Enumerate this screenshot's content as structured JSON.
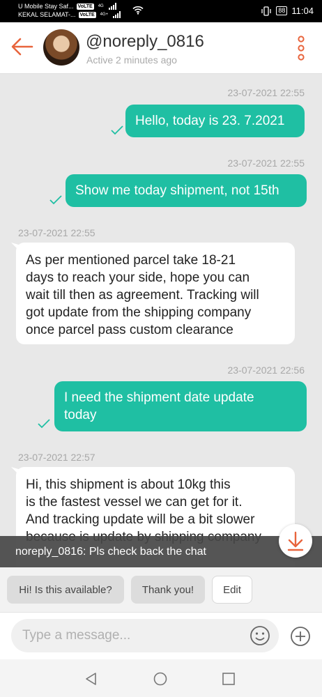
{
  "status_bar": {
    "carrier_line1": "U Mobile Stay Saf...",
    "carrier_line2": "KEKAL SELAMAT-...",
    "volte": "VoLTE",
    "net1": "4G",
    "net2": "4G+",
    "battery": "88",
    "time": "11:04"
  },
  "header": {
    "username": "@noreply_0816",
    "active_status": "Active 2 minutes ago"
  },
  "messages": [
    {
      "direction": "out",
      "timestamp": "23-07-2021 22:55",
      "lines": [
        "Hello, today is 23. 7.2021"
      ]
    },
    {
      "direction": "out",
      "timestamp": "23-07-2021 22:55",
      "lines": [
        "Show me today shipment, not 15th"
      ]
    },
    {
      "direction": "in",
      "timestamp": "23-07-2021 22:55",
      "lines": [
        "As per mentioned parcel take 18-21",
        "days to reach your side, hope you can",
        "wait till then as agreement. Tracking will",
        "got update from the shipping company",
        "once parcel pass custom clearance"
      ]
    },
    {
      "direction": "out",
      "timestamp": "23-07-2021 22:56",
      "lines": [
        "I need the shipment date update",
        "today"
      ]
    },
    {
      "direction": "in",
      "timestamp": "23-07-2021 22:57",
      "lines": [
        "Hi, this shipment is about 10kg this",
        "is the fastest vessel we can get for it.",
        "And tracking update will be a bit slower",
        "because is update by shipping company"
      ]
    }
  ],
  "banner": {
    "text": "noreply_0816: Pls check back the chat"
  },
  "quick_replies": [
    "Hi! Is this available?",
    "Thank you!",
    "Edit"
  ],
  "input": {
    "placeholder": "Type a message..."
  },
  "colors": {
    "accent": "#e8643c",
    "outgoing_bubble": "#1fbfa3",
    "check": "#1fbfa3"
  },
  "icons": [
    "back-arrow-icon",
    "more-vertical-icon",
    "check-icon",
    "scroll-down-icon",
    "emoji-icon",
    "plus-icon",
    "nav-back-icon",
    "nav-home-icon",
    "nav-recent-icon",
    "wifi-icon",
    "signal-icon",
    "battery-icon",
    "vibrate-icon"
  ]
}
